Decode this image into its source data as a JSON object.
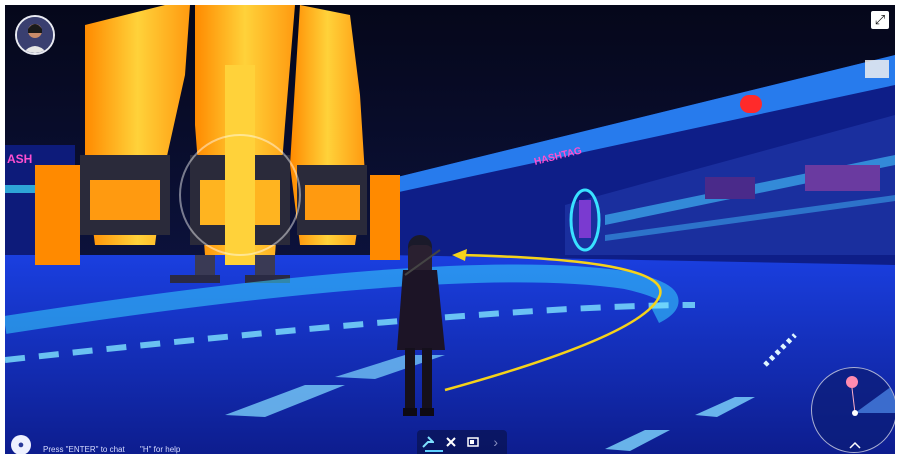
{
  "hud": {
    "chat_hint": "Press \"ENTER\" to chat",
    "help_hint": "\"H\" for help",
    "toolbar_next": "›"
  },
  "icons": {
    "avatar": "player-avatar",
    "expand": "expand-icon",
    "chat": "chat-bubble-icon",
    "toolbar": [
      "walk-mode-icon",
      "emote-icon",
      "gallery-icon",
      "chevron-right-icon"
    ],
    "minimap": "minimap"
  },
  "banners": {
    "hashtag_left": "ASH",
    "hashtag_right": "HASHTAG"
  },
  "colors": {
    "sky": "#0a0f2e",
    "floor": "#1230c8",
    "neon_cyan": "#37d4ff",
    "path_arrow": "#f5d21a",
    "mech_orange": "#ffae1a"
  }
}
